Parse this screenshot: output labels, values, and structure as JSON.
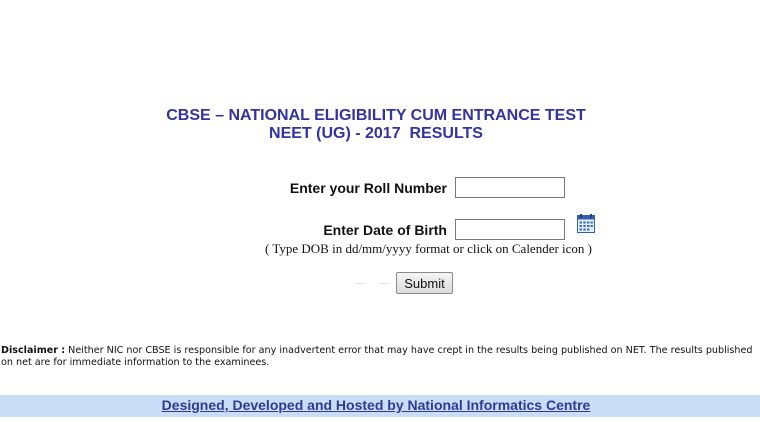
{
  "header": {
    "title_line1": "CBSE – NATIONAL ELIGIBILITY CUM ENTRANCE TEST",
    "title_line2": "NEET (UG) - 2017  RESULTS"
  },
  "form": {
    "roll_label": "Enter your Roll Number",
    "roll_value": "",
    "dob_label": "Enter Date of Birth",
    "dob_value": "",
    "calendar_icon": "calendar-icon",
    "dob_hint": "( Type DOB in dd/mm/yyyy format or click on Calender icon )",
    "submit_label": "Submit"
  },
  "disclaimer": {
    "label": "Disclaimer :",
    "text": " Neither NIC nor CBSE is responsible for any inadvertent error that may have crept in the results being published on NET. The results published on net are for immediate information to the examinees."
  },
  "footer": {
    "link_text": "Designed, Developed and Hosted by National Informatics Centre"
  },
  "colors": {
    "title": "#3333a3",
    "footer_bg": "#c9ddf7",
    "footer_link": "#2f3a96"
  }
}
